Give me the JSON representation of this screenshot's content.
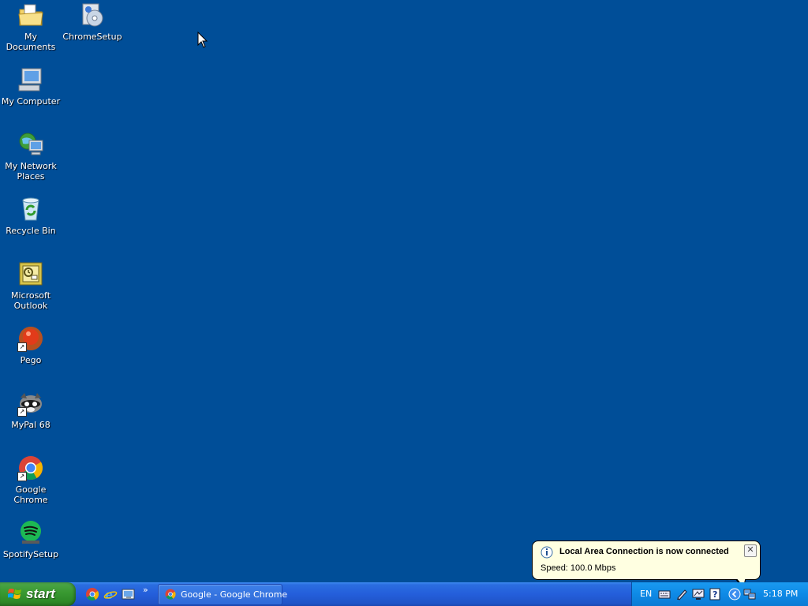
{
  "desktop": {
    "background": "#004e98",
    "icons": [
      {
        "label": "My Documents",
        "icon": "folder-documents-icon"
      },
      {
        "label": "ChromeSetup",
        "icon": "setup-cd-icon"
      },
      {
        "label": "My Computer",
        "icon": "computer-icon"
      },
      {
        "label": "My Network Places",
        "icon": "network-places-icon"
      },
      {
        "label": "Recycle Bin",
        "icon": "recycle-bin-icon"
      },
      {
        "label": "Microsoft Outlook",
        "icon": "outlook-icon"
      },
      {
        "label": "Pego",
        "icon": "pego-icon"
      },
      {
        "label": "MyPal 68",
        "icon": "mypal-icon"
      },
      {
        "label": "Google Chrome",
        "icon": "chrome-icon"
      },
      {
        "label": "SpotifySetup",
        "icon": "spotify-icon"
      }
    ]
  },
  "taskbar": {
    "start_label": "start",
    "quick_launch": [
      "chrome-icon",
      "ie-icon",
      "show-desktop-icon"
    ],
    "quick_launch_more": "»",
    "tasks": [
      {
        "label": "Google - Google Chrome",
        "icon": "chrome-icon"
      }
    ],
    "tray": {
      "language": "EN",
      "icons": [
        "keyboard-icon",
        "pen-icon",
        "monitor-icon",
        "help-icon",
        "show-hidden-icon",
        "network-icon"
      ],
      "clock": "5:18 PM"
    }
  },
  "notification": {
    "title": "Local Area Connection is now connected",
    "text": "Speed: 100.0 Mbps",
    "close_glyph": "✕"
  }
}
